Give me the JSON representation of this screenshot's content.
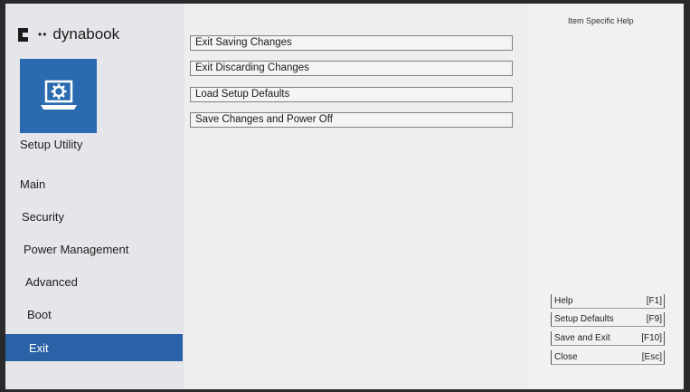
{
  "brand": {
    "name": "dynabook",
    "dots": "••"
  },
  "sidebar": {
    "title": "Setup Utility",
    "items": [
      {
        "label": "Main",
        "active": false
      },
      {
        "label": "Security",
        "active": false
      },
      {
        "label": "Power Management",
        "active": false
      },
      {
        "label": "Advanced",
        "active": false
      },
      {
        "label": "Boot",
        "active": false
      },
      {
        "label": "Exit",
        "active": true
      }
    ]
  },
  "main": {
    "options": [
      {
        "label": "Exit Saving Changes"
      },
      {
        "label": "Exit Discarding Changes"
      },
      {
        "label": "Load Setup Defaults"
      },
      {
        "label": "Save Changes and Power Off"
      }
    ]
  },
  "help": {
    "title": "Item Specific Help",
    "keys": [
      {
        "label": "Help",
        "key": "[F1]"
      },
      {
        "label": "Setup Defaults",
        "key": "[F9]"
      },
      {
        "label": "Save and Exit",
        "key": "[F10]"
      },
      {
        "label": "Close",
        "key": "[Esc]"
      }
    ]
  },
  "colors": {
    "accent": "#2a62a8",
    "tile": "#2a6ab0"
  },
  "icons": {
    "setup": "laptop-gear-icon",
    "logo": "dynabook-logo-icon"
  }
}
